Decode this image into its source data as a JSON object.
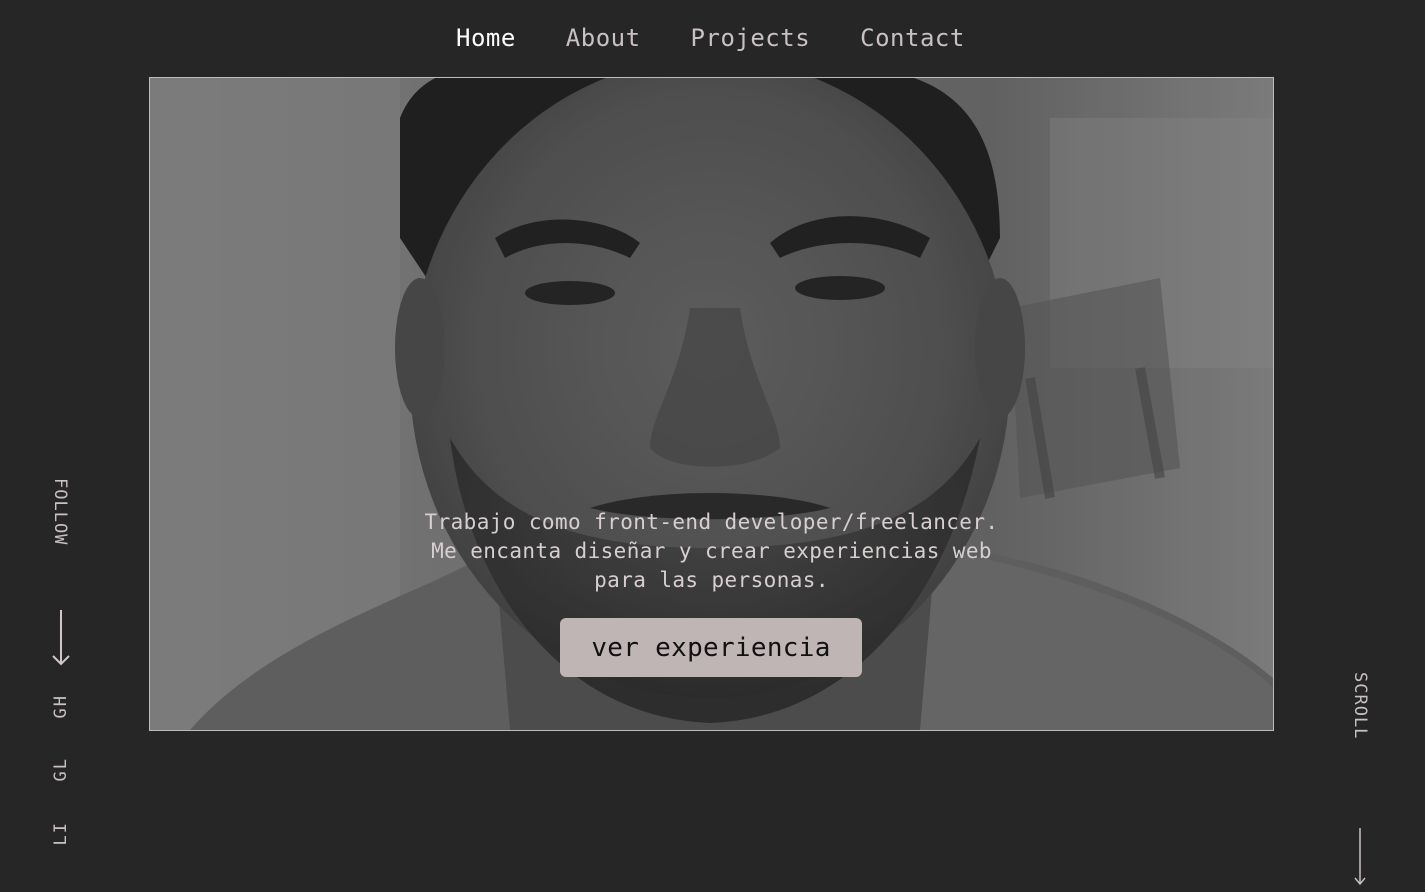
{
  "nav": {
    "items": [
      {
        "label": "Home",
        "active": true
      },
      {
        "label": "About",
        "active": false
      },
      {
        "label": "Projects",
        "active": false
      },
      {
        "label": "Contact",
        "active": false
      }
    ]
  },
  "hero": {
    "lines": [
      "Trabajo como front-end developer/freelancer.",
      "Me encanta diseñar y crear experiencias web",
      "para las personas."
    ],
    "cta_label": "ver experiencia"
  },
  "follow": {
    "label": "FOLLOW",
    "arrow_icon": "arrow-down-icon",
    "links": [
      "GH",
      "GL",
      "LI"
    ]
  },
  "scroll": {
    "label": "SCROLL",
    "arrow_icon": "arrow-down-icon"
  },
  "colors": {
    "background": "#262626",
    "nav_text": "#c9c1c1",
    "nav_active": "#ffffff",
    "button_bg": "#bfb5b5",
    "hero_text": "#d7cfcf"
  }
}
